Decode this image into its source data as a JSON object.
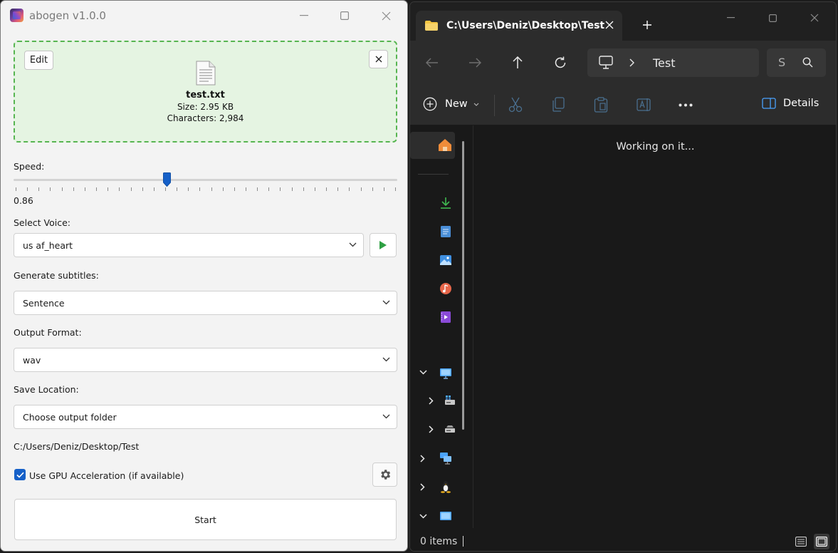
{
  "abogen": {
    "title": "abogen v1.0.0",
    "file": {
      "edit_label": "Edit",
      "name": "test.txt",
      "size": "Size: 2.95 KB",
      "characters": "Characters: 2,984"
    },
    "speed": {
      "label": "Speed:",
      "value_text": "0.86",
      "level_fraction": 0.4
    },
    "voice": {
      "label": "Select Voice:",
      "selected": "us af_heart"
    },
    "subtitles": {
      "label": "Generate subtitles:",
      "selected": "Sentence"
    },
    "output_format": {
      "label": "Output Format:",
      "selected": "wav"
    },
    "save_location": {
      "label": "Save Location:",
      "selected": "Choose output folder",
      "path": "C:/Users/Deniz/Desktop/Test"
    },
    "gpu": {
      "label": "Use GPU Acceleration (if available)",
      "checked": true
    },
    "start_label": "Start",
    "colors": {
      "dropzone_bg": "#e5f4e2",
      "dropzone_border": "#57b551",
      "accent": "#1560c8",
      "play": "#2ea043"
    }
  },
  "explorer": {
    "tab_title": "C:\\Users\\Deniz\\Desktop\\Test",
    "address": {
      "current": "Test"
    },
    "search_placeholder": "S",
    "new_label": "New",
    "details_label": "Details",
    "loading_text": "Working on it...",
    "status_text": "0 items",
    "icons": [
      "back-icon",
      "forward-icon",
      "up-icon",
      "refresh-icon",
      "cut-icon",
      "copy-icon",
      "paste-icon",
      "rename-icon",
      "more-icon"
    ]
  }
}
